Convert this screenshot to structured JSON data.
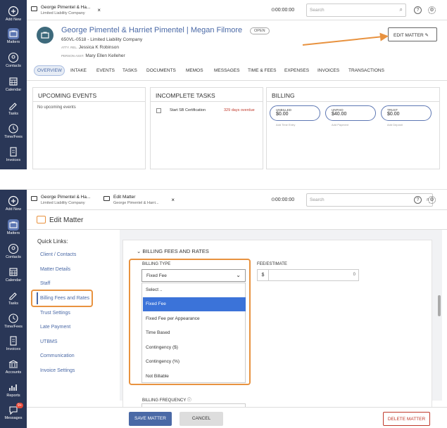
{
  "sidebar_top": {
    "add_new": "Add New",
    "matters": "Matters",
    "contacts": "Contacts",
    "calendar": "Calendar",
    "tasks": "Tasks",
    "time_fees": "Time/Fees",
    "invoices": "Invoices"
  },
  "sidebar_bottom": {
    "add_new": "Add New",
    "matters": "Matters",
    "contacts": "Contacts",
    "calendar": "Calendar",
    "tasks": "Tasks",
    "time_fees": "Time/Fees",
    "invoices": "Invoices",
    "accounts": "Accounts",
    "reports": "Reports",
    "messages": "Messages",
    "messages_badge": "9+"
  },
  "top": {
    "tab_title": "George Pimentel & Ha...",
    "tab_subtitle": "Limited Liability Company",
    "timer": "00:00:00",
    "search_placeholder": "Search"
  },
  "matter": {
    "title": "George Pimentel & Harriet Pimentel | Megan Filmore",
    "status": "OPEN",
    "number_line": "650VL-0518 - Limited Liability Company",
    "atty_label": "ATTY. REL.",
    "atty": "Jessica K Robinson",
    "asst_label": "PERSON ASST.",
    "asst": "Mary Ellen Kelleher",
    "edit_button": "EDIT MATTER"
  },
  "tabs": [
    "OVERVIEW",
    "INTAKE",
    "EVENTS",
    "TASKS",
    "DOCUMENTS",
    "MEMOS",
    "MESSAGES",
    "TIME & FEES",
    "EXPENSES",
    "INVOICES",
    "TRANSACTIONS"
  ],
  "cards": {
    "upcoming_title": "UPCOMING EVENTS",
    "upcoming_empty": "No upcoming events",
    "tasks_title": "INCOMPLETE TASKS",
    "task_name": "Start SB Certification",
    "task_due": "329 days overdue",
    "billing_title": "BILLING",
    "billing": [
      {
        "label": "UNBILLED",
        "value": "$0.00",
        "sub": "Add Time Entry"
      },
      {
        "label": "UNPAID",
        "value": "$40.00",
        "sub": "Add Payment"
      },
      {
        "label": "TRUST",
        "value": "$0.00",
        "sub": "Add Deposit"
      }
    ]
  },
  "bottom": {
    "tab1_title": "George Pimentel & Ha...",
    "tab1_sub": "Limited Liability Company",
    "tab2_title": "Edit Matter",
    "tab2_sub": "George Pimentel & Harri...",
    "timer": "00:00:00",
    "search_placeholder": "Search",
    "page_title": "Edit Matter",
    "quick_links_title": "Quick Links:",
    "quick_links": [
      "Client / Contacts",
      "Matter Details",
      "Staff",
      "Billing Fees and Rates",
      "Trust Settings",
      "Late Payment",
      "UTBMS",
      "Communication",
      "Invoice Settings"
    ],
    "section_title": "BILLING FEES AND RATES",
    "billing_type_label": "BILLING TYPE",
    "billing_type_value": "Fixed Fee",
    "fee_label": "FEE/ESTIMATE",
    "fee_currency": "$",
    "fee_value": "0",
    "options": [
      "Select ..",
      "Fixed Fee",
      "Fixed Fee per Appearance",
      "Time Based",
      "Contingency ($)",
      "Contingency (%)",
      "Not Billable"
    ],
    "frequency_label": "BILLING FREQUENCY",
    "save": "SAVE MATTER",
    "cancel": "CANCEL",
    "delete": "DELETE MATTER"
  },
  "colors": {
    "sidebar": "#2a3757",
    "accent": "#4a69a6",
    "orange": "#e8923f",
    "selected": "#3b73d9"
  }
}
